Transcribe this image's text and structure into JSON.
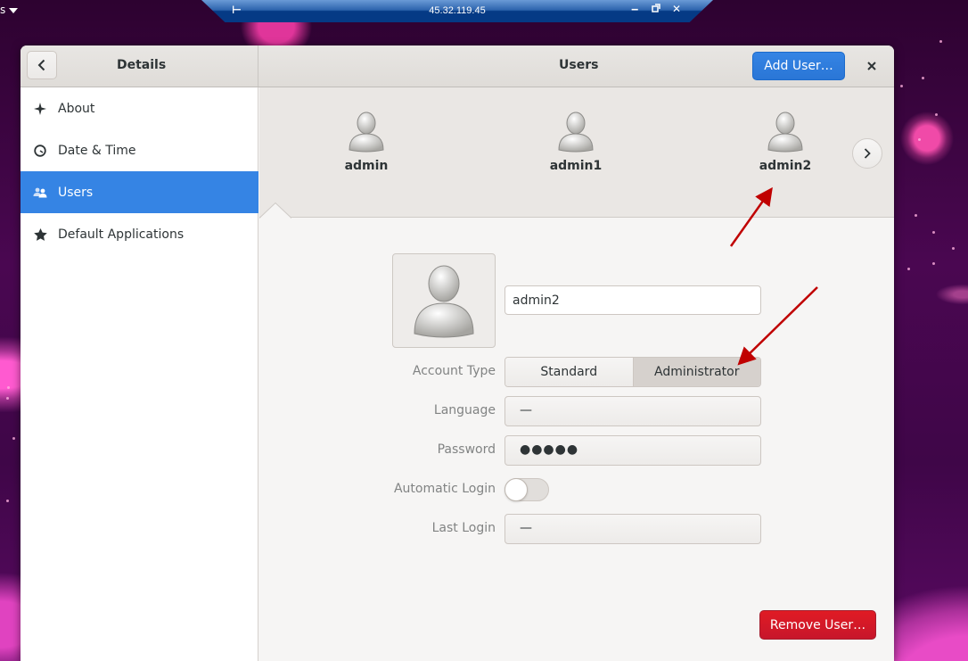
{
  "desktop": {
    "topbar_fragment": "s",
    "remote_bar": {
      "host": "45.32.119.45",
      "pin_icon": "pin-icon",
      "minimize_icon": "minimize-icon",
      "restore_icon": "restore-icon",
      "close_icon": "close-icon"
    }
  },
  "window": {
    "left_header": {
      "back_icon": "chevron-left-icon",
      "title": "Details"
    },
    "right_header": {
      "title": "Users",
      "add_user_label": "Add User…",
      "close_icon": "close-icon"
    },
    "sidebar": {
      "items": [
        {
          "label": "About",
          "icon": "sparkle-icon",
          "active": false
        },
        {
          "label": "Date & Time",
          "icon": "clock-icon",
          "active": false
        },
        {
          "label": "Users",
          "icon": "users-icon",
          "active": true
        },
        {
          "label": "Default Applications",
          "icon": "star-icon",
          "active": false
        }
      ]
    },
    "users_carousel": {
      "users": [
        {
          "name": "admin"
        },
        {
          "name": "admin1"
        },
        {
          "name": "admin2",
          "selected": true
        }
      ],
      "next_icon": "chevron-right-icon"
    },
    "details": {
      "full_name": "admin2",
      "account_type": {
        "label": "Account Type",
        "options": [
          "Standard",
          "Administrator"
        ],
        "selected": "Administrator"
      },
      "language": {
        "label": "Language",
        "value": "—"
      },
      "password": {
        "label": "Password",
        "value": "●●●●●"
      },
      "automatic_login": {
        "label": "Automatic Login",
        "enabled": false
      },
      "last_login": {
        "label": "Last Login",
        "value": "—"
      },
      "remove_user_label": "Remove User…"
    }
  },
  "annotations": {
    "arrow_color": "#c00000",
    "arrows": [
      "points-to-admin2-user",
      "points-to-administrator-option"
    ]
  },
  "colors": {
    "accent": "#3584e4",
    "destructive": "#e01b24",
    "remote_bar": "#053a85"
  }
}
